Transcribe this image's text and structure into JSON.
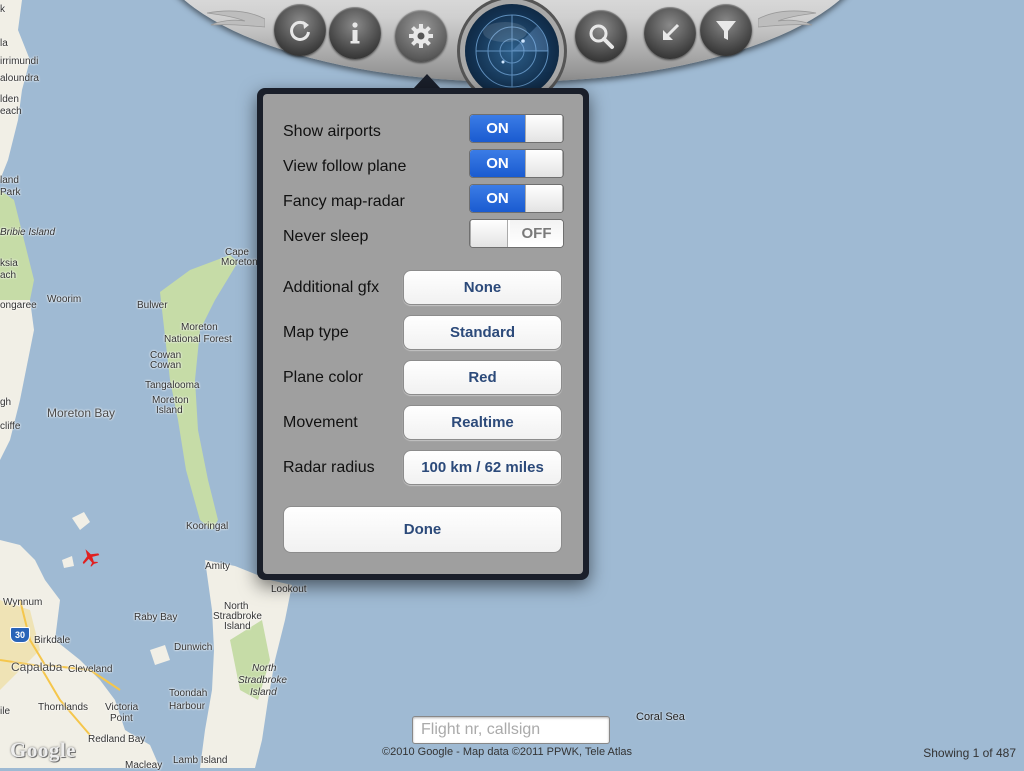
{
  "toolbar": {
    "buttons": [
      {
        "name": "refresh",
        "icon": "refresh-icon"
      },
      {
        "name": "info",
        "icon": "info-icon"
      },
      {
        "name": "settings",
        "icon": "gear-icon"
      },
      {
        "name": "radar",
        "icon": "radar-icon"
      },
      {
        "name": "search",
        "icon": "magnifier-icon"
      },
      {
        "name": "collapse",
        "icon": "arrow-collapse-icon"
      },
      {
        "name": "filter",
        "icon": "filter-icon"
      }
    ]
  },
  "settings": {
    "toggles": [
      {
        "label": "Show airports",
        "state": "ON"
      },
      {
        "label": "View follow plane",
        "state": "ON"
      },
      {
        "label": "Fancy map-radar",
        "state": "ON"
      },
      {
        "label": "Never sleep",
        "state": "OFF"
      }
    ],
    "options": [
      {
        "label": "Additional gfx",
        "value": "None"
      },
      {
        "label": "Map type",
        "value": "Standard"
      },
      {
        "label": "Plane color",
        "value": "Red"
      },
      {
        "label": "Movement",
        "value": "Realtime"
      },
      {
        "label": "Radar radius",
        "value": "100 km / 62 miles"
      }
    ],
    "done_label": "Done"
  },
  "search": {
    "placeholder": "Flight nr, callsign"
  },
  "footer": {
    "logo": "Google",
    "copyright": "©2010 Google - Map data ©2011 PPWK, Tele Atlas",
    "showing": "Showing 1 of 487"
  },
  "map": {
    "road_shield": "30",
    "labels": [
      "k",
      "la",
      "irrimundi",
      "aloundra",
      "lden",
      "each",
      "land",
      "Park",
      "Bribie Island",
      "ksia",
      "ach",
      "ongaree",
      "Woorim",
      "Cape",
      "Moreton",
      "Bulwer",
      "Moreton",
      "National Forest",
      "Cowan",
      "Cowan",
      "Tangalooma",
      "Moreton",
      "Island",
      "gh",
      "Moreton Bay",
      "cliffe",
      "Kooringal",
      "Amity",
      "Lookout",
      "Wynnum",
      "North",
      "Stradbroke",
      "Island",
      "Birkdale",
      "Raby Bay",
      "Dunwich",
      "Capalaba",
      "Cleveland",
      "North",
      "Stradbroke",
      "Island",
      "Toondah",
      "Harbour",
      "ile",
      "Thornlands",
      "Victoria",
      "Point",
      "Redland Bay",
      "Lamb Island",
      "Macleay",
      "Coral Sea"
    ]
  },
  "colors": {
    "water": "#9fbad3",
    "land": "#f1efe6",
    "park": "#c6dca7",
    "toggle_on": "#1a5bd0",
    "button_text": "#2c4a7a",
    "plane": "#e02020"
  }
}
